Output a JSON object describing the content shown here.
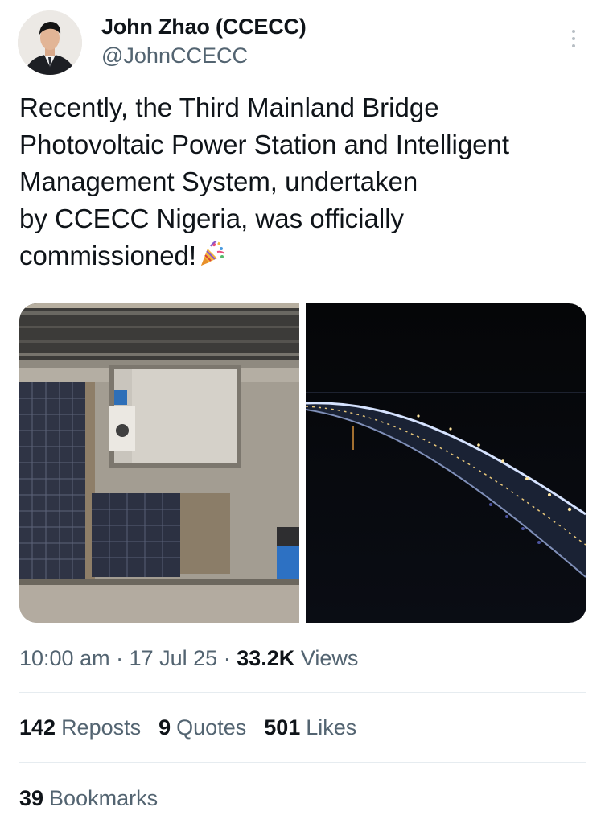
{
  "author": {
    "name": "John Zhao (CCECC)",
    "handle": "@JohnCCECC"
  },
  "tweet": {
    "text": "Recently, the Third Mainland Bridge\nPhotovoltaic Power Station and Intelligent\nManagement System, undertaken\nby CCECC Nigeria, was officially\ncommissioned!",
    "emoji": "party-popper-icon"
  },
  "media": [
    {
      "icon": "aerial-solar-station-photo"
    },
    {
      "icon": "night-bridge-photo"
    }
  ],
  "meta": {
    "time": "10:00 am",
    "separator": "·",
    "date": "17 Jul 25",
    "views_count": "33.2K",
    "views_label": "Views"
  },
  "stats": {
    "reposts_count": "142",
    "reposts_label": "Reposts",
    "quotes_count": "9",
    "quotes_label": "Quotes",
    "likes_count": "501",
    "likes_label": "Likes",
    "bookmarks_count": "39",
    "bookmarks_label": "Bookmarks"
  },
  "colors": {
    "text": "#0f1419",
    "secondary": "#536471",
    "divider": "#e6ecf0"
  }
}
